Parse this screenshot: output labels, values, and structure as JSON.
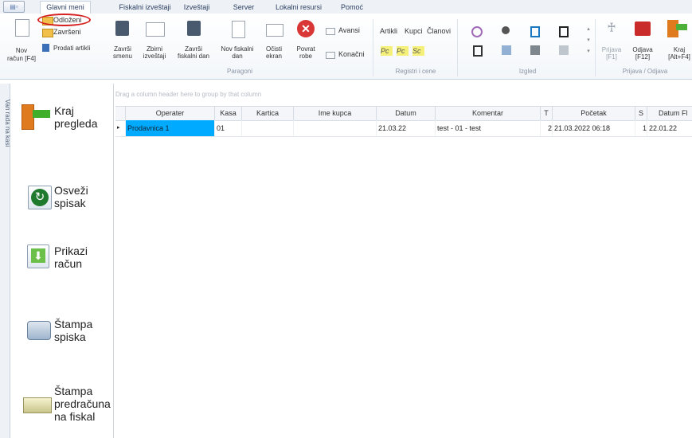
{
  "tabs": {
    "glavni_meni": "Glavni meni",
    "fiskalni_izvestaji": "Fiskalni izveštaji",
    "izvestaji": "Izveštaji",
    "server": "Server",
    "lokalni_resursi": "Lokalni resursi",
    "pomoc": "Pomoć"
  },
  "ribbon": {
    "nov_racun": "Nov",
    "nov_racun_2": "račun [F4]",
    "odlozeni": "Odloženi",
    "zavrseni": "Završeni",
    "prodati_artikli": "Prodati artikli",
    "zavrsi_smenu_1": "Završi",
    "zavrsi_smenu_2": "smenu",
    "zbirni_1": "Zbirni",
    "zbirni_2": "izveštaji",
    "zavrsi_fiskalni_1": "Završi",
    "zavrsi_fiskalni_2": "fiskalni dan",
    "nov_fiskalni_1": "Nov fiskalni",
    "nov_fiskalni_2": "dan",
    "ocisti_1": "Očisti",
    "ocisti_2": "ekran",
    "povrat_1": "Povrat",
    "povrat_2": "robe",
    "avansi": "Avansi",
    "konacni": "Konačni",
    "paragoni_label": "Paragoni",
    "artikli": "Artikli",
    "kupci": "Kupci",
    "clanovi": "Članovi",
    "registri_label": "Registri i cene",
    "izgled_label": "Izgled",
    "prijava_1": "Prijava",
    "prijava_2": "[F1]",
    "odjava_1": "Odjava",
    "odjava_2": "[F12]",
    "kraj_1": "Kraj",
    "kraj_2": "[Alt+F4]",
    "prijava_odjava_label": "Prijava / Odjava"
  },
  "sidebar": {
    "vertical_text": "Van rada na kasi",
    "kraj_pregleda_1": "Kraj",
    "kraj_pregleda_2": "pregleda",
    "osvezi_1": "Osveži",
    "osvezi_2": "spisak",
    "prikazi_1": "Prikazi",
    "prikazi_2": "račun",
    "stampa_spiska_1": "Štampa",
    "stampa_spiska_2": "spiska",
    "stampa_pred_1": "Štampa",
    "stampa_pred_2": "predračuna",
    "stampa_pred_3": "na fiskal"
  },
  "grid": {
    "group_hint": "Drag a column header here to group by that column",
    "columns": [
      "Operater",
      "Kasa",
      "Kartica",
      "Ime kupca",
      "Datum",
      "Komentar",
      "T",
      "Početak",
      "S",
      "Datum Fl"
    ],
    "rows": [
      [
        "Prodavnica 1",
        "01",
        "",
        "",
        "21.03.22",
        "test - 01 - test",
        "2",
        "21.03.2022 06:18",
        "1",
        "22.01.22"
      ]
    ]
  },
  "colors": {
    "accent": "#00aaff",
    "highlight_circle": "#d62020"
  }
}
